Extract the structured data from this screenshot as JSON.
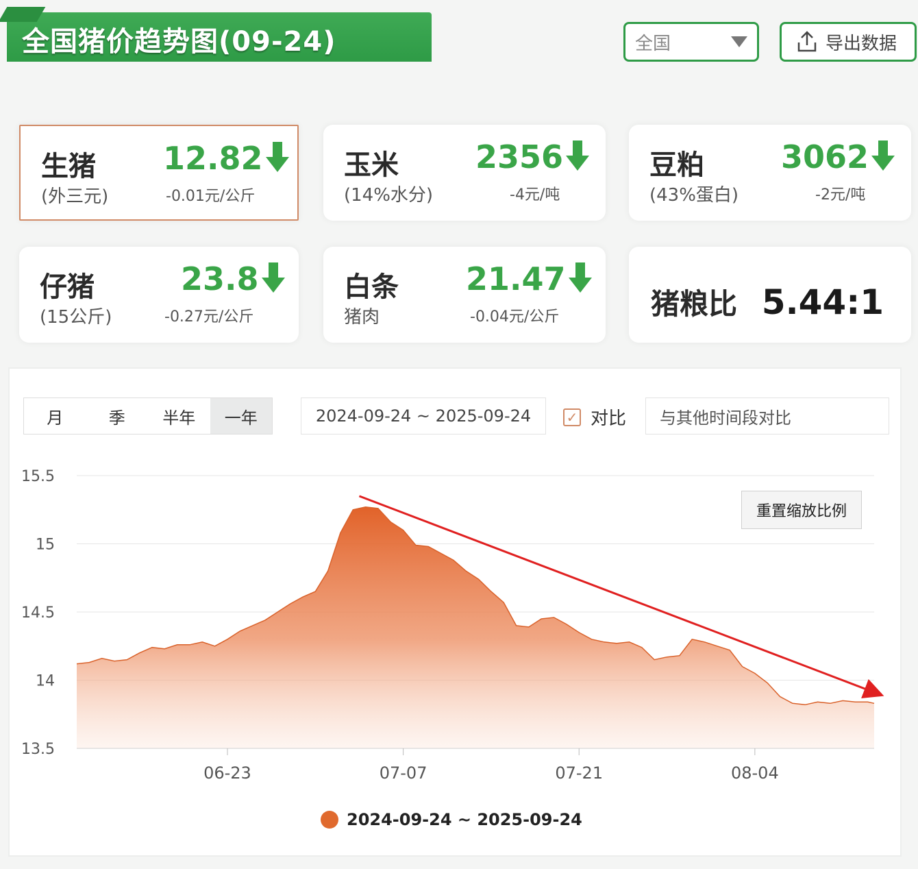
{
  "header": {
    "title": "全国猪价趋势图(09-24)",
    "region_select": "全国",
    "export_label": "导出数据"
  },
  "cards": {
    "hog": {
      "name": "生猪",
      "sub": "(外三元)",
      "value": "12.82",
      "change": "-0.01元/公斤",
      "trend": "down"
    },
    "corn": {
      "name": "玉米",
      "sub": "(14%水分)",
      "value": "2356",
      "change": "-4元/吨",
      "trend": "down"
    },
    "soymeal": {
      "name": "豆粕",
      "sub": "(43%蛋白)",
      "value": "3062",
      "change": "-2元/吨",
      "trend": "down"
    },
    "piglet": {
      "name": "仔猪",
      "sub": "(15公斤)",
      "value": "23.8",
      "change": "-0.27元/公斤",
      "trend": "down"
    },
    "pork": {
      "name": "白条",
      "sub": "猪肉",
      "value": "21.47",
      "change": "-0.04元/公斤",
      "trend": "down"
    },
    "ratio": {
      "name": "猪粮比",
      "value": "5.44:1"
    }
  },
  "chart_controls": {
    "period_tabs": [
      "月",
      "季",
      "半年",
      "一年"
    ],
    "active_tab": "一年",
    "date_range": "2024-09-24 ~ 2025-09-24",
    "compare_checked": true,
    "compare_label": "对比",
    "compare_placeholder": "与其他时间段对比",
    "reset_zoom_label": "重置缩放比例"
  },
  "colors": {
    "brand_green": "#2e9b46",
    "down_green": "#3aa548",
    "series_orange": "#e06a2e",
    "annotation_red": "#e02020"
  },
  "chart_data": {
    "type": "area",
    "legend": "2024-09-24 ~ 2025-09-24",
    "ylim": [
      13.5,
      15.5
    ],
    "y_ticks": [
      "15.5",
      "15",
      "14.5",
      "14",
      "13.5"
    ],
    "x_ticks": [
      "06-23",
      "07-07",
      "07-21",
      "08-04"
    ],
    "x_tick_days": [
      12,
      26,
      40,
      54
    ],
    "x_days_range": [
      0,
      63.5
    ],
    "grid": true,
    "trend_arrow": "down",
    "series": [
      {
        "x": [
          0,
          1,
          2,
          3,
          4,
          5,
          6,
          7,
          8,
          9,
          10,
          11,
          12,
          13,
          14,
          15,
          16,
          17,
          18,
          19,
          20,
          21,
          22,
          23,
          24,
          25,
          26,
          27,
          28,
          29,
          30,
          31,
          32,
          33,
          34,
          35,
          36,
          37,
          38,
          39,
          40,
          41,
          42,
          43,
          44,
          45,
          46,
          47,
          48,
          49,
          50,
          51,
          52,
          53,
          54,
          55,
          56,
          57,
          58,
          59,
          60,
          61,
          62,
          63,
          63.5
        ],
        "values": [
          14.12,
          14.13,
          14.16,
          14.14,
          14.15,
          14.2,
          14.24,
          14.23,
          14.26,
          14.26,
          14.28,
          14.25,
          14.3,
          14.36,
          14.4,
          14.44,
          14.5,
          14.56,
          14.61,
          14.65,
          14.8,
          15.08,
          15.25,
          15.27,
          15.26,
          15.16,
          15.1,
          14.99,
          14.98,
          14.93,
          14.88,
          14.8,
          14.74,
          14.65,
          14.57,
          14.4,
          14.39,
          14.45,
          14.46,
          14.41,
          14.35,
          14.3,
          14.28,
          14.27,
          14.28,
          14.24,
          14.15,
          14.17,
          14.18,
          14.3,
          14.28,
          14.25,
          14.22,
          14.1,
          14.05,
          13.98,
          13.88,
          13.83,
          13.82,
          13.84,
          13.83,
          13.85,
          13.84,
          13.84,
          13.83
        ]
      }
    ]
  }
}
